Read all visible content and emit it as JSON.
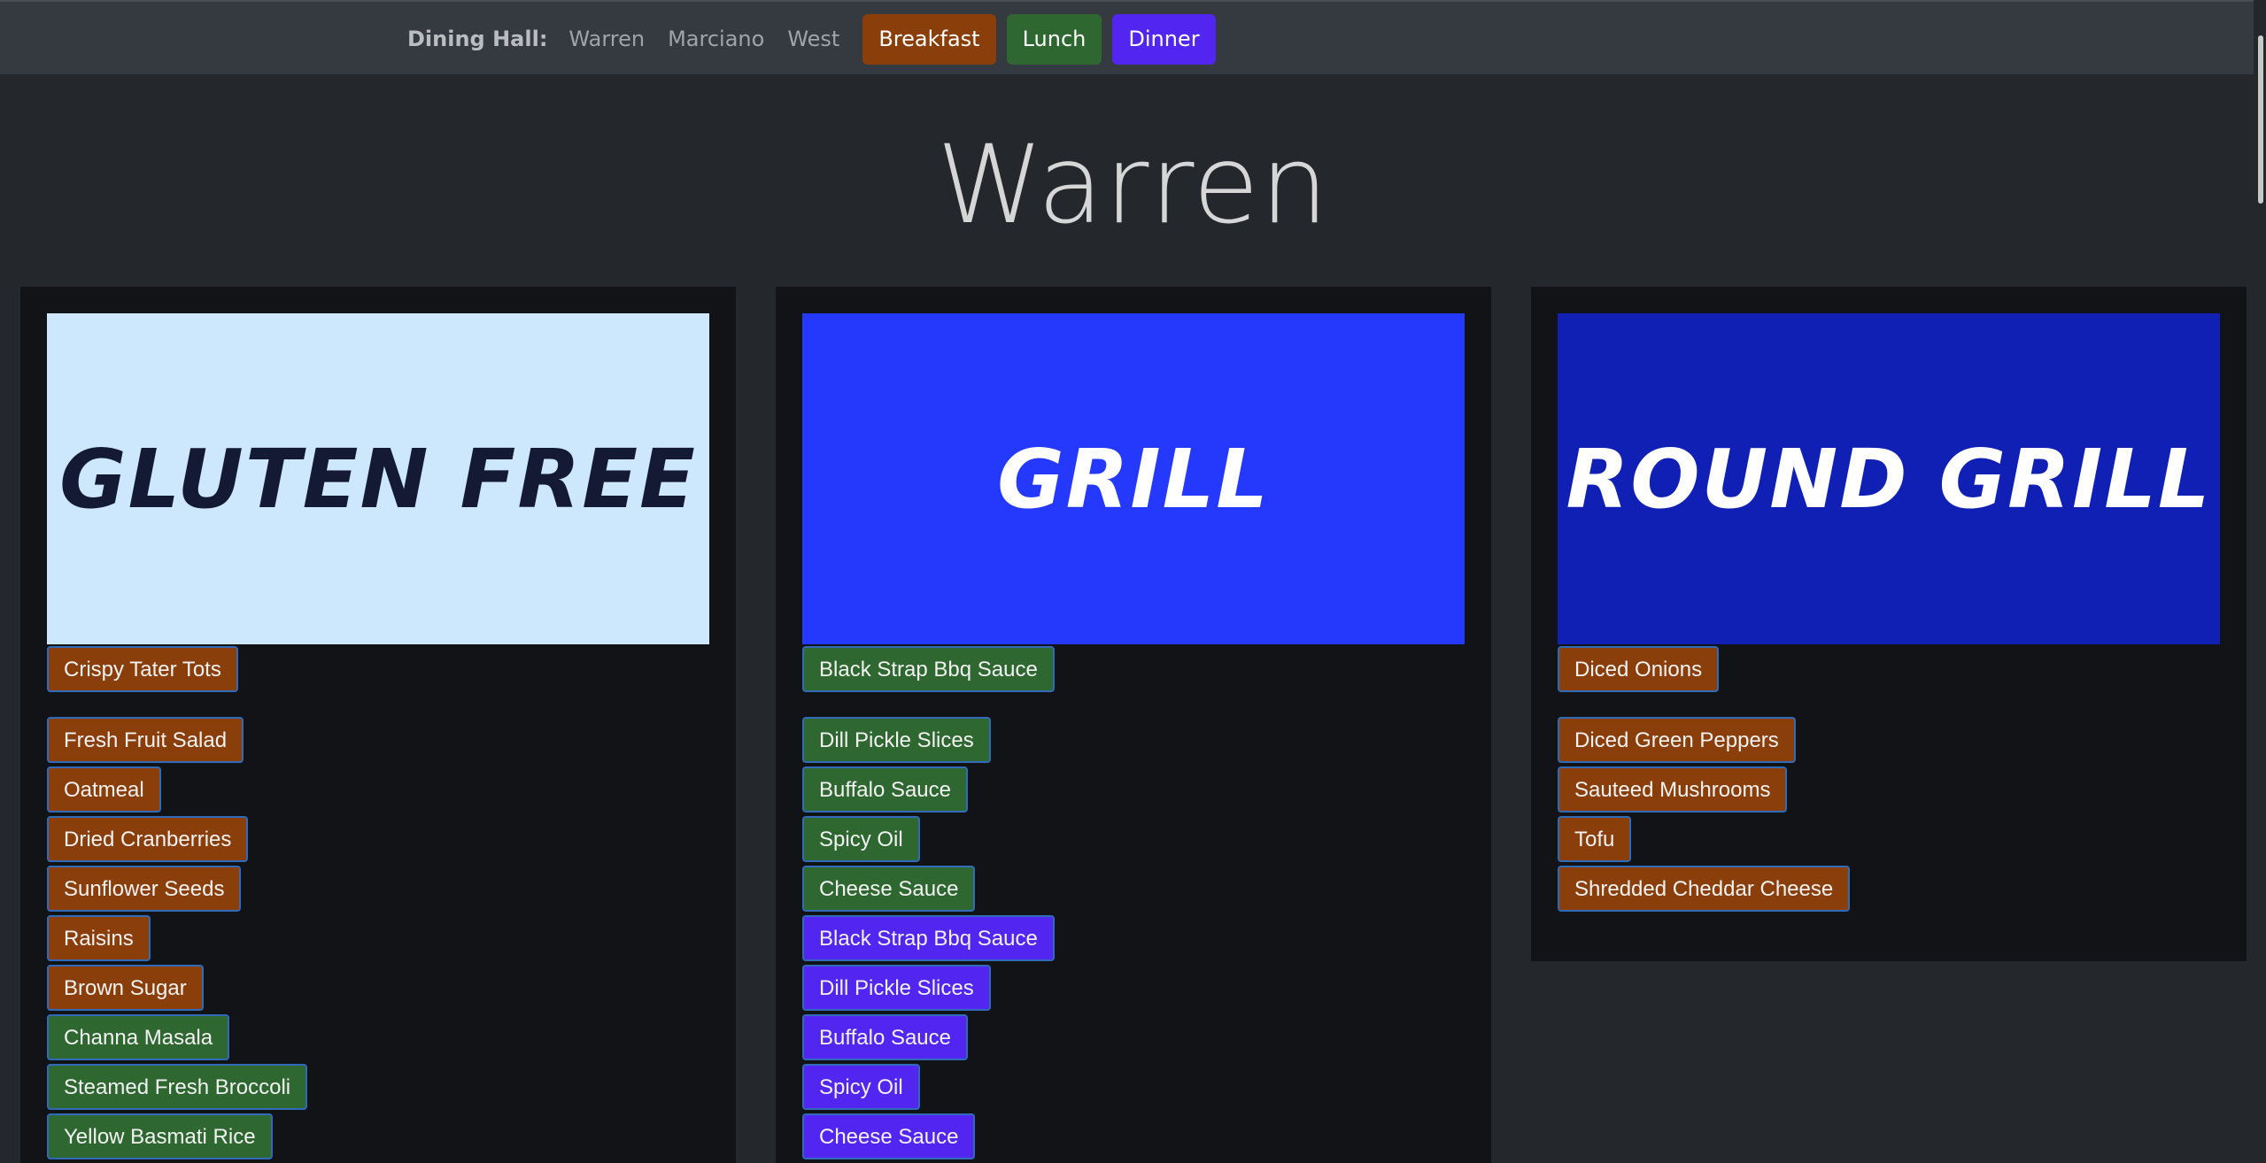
{
  "nav": {
    "brand": "Dining Hall:",
    "halls": [
      "Warren",
      "Marciano",
      "West"
    ],
    "meals": [
      {
        "label": "Breakfast",
        "color": "#8a3f0a"
      },
      {
        "label": "Lunch",
        "color": "#2f6731"
      },
      {
        "label": "Dinner",
        "color": "#5226f0"
      }
    ]
  },
  "page": {
    "title": "Warren"
  },
  "stations": [
    {
      "name": "GLUTEN FREE",
      "banner_bg": "#cde7fd",
      "banner_fg": "#141a33",
      "items": [
        {
          "label": "Crispy Tater Tots",
          "meal": "breakfast"
        },
        {
          "label": "Fresh Fruit Salad",
          "meal": "breakfast"
        },
        {
          "label": "Oatmeal",
          "meal": "breakfast"
        },
        {
          "label": "Dried Cranberries",
          "meal": "breakfast"
        },
        {
          "label": "Sunflower Seeds",
          "meal": "breakfast"
        },
        {
          "label": "Raisins",
          "meal": "breakfast"
        },
        {
          "label": "Brown Sugar",
          "meal": "breakfast"
        },
        {
          "label": "Channa Masala",
          "meal": "lunch"
        },
        {
          "label": "Steamed Fresh Broccoli",
          "meal": "lunch"
        },
        {
          "label": "Yellow Basmati Rice",
          "meal": "lunch"
        }
      ]
    },
    {
      "name": "GRILL",
      "banner_bg": "#2439fb",
      "banner_fg": "#ffffff",
      "items": [
        {
          "label": "Black Strap Bbq Sauce",
          "meal": "lunch"
        },
        {
          "label": "Dill Pickle Slices",
          "meal": "lunch"
        },
        {
          "label": "Buffalo Sauce",
          "meal": "lunch"
        },
        {
          "label": "Spicy Oil",
          "meal": "lunch"
        },
        {
          "label": "Cheese Sauce",
          "meal": "lunch"
        },
        {
          "label": "Black Strap Bbq Sauce",
          "meal": "dinner"
        },
        {
          "label": "Dill Pickle Slices",
          "meal": "dinner"
        },
        {
          "label": "Buffalo Sauce",
          "meal": "dinner"
        },
        {
          "label": "Spicy Oil",
          "meal": "dinner"
        },
        {
          "label": "Cheese Sauce",
          "meal": "dinner"
        }
      ]
    },
    {
      "name": "ROUND GRILL",
      "banner_bg": "#1020b4",
      "banner_fg": "#ffffff",
      "items": [
        {
          "label": "Diced Onions",
          "meal": "breakfast"
        },
        {
          "label": "Diced Green Peppers",
          "meal": "breakfast"
        },
        {
          "label": "Sauteed Mushrooms",
          "meal": "breakfast"
        },
        {
          "label": "Tofu",
          "meal": "breakfast"
        },
        {
          "label": "Shredded Cheddar Cheese",
          "meal": "breakfast"
        }
      ]
    }
  ]
}
